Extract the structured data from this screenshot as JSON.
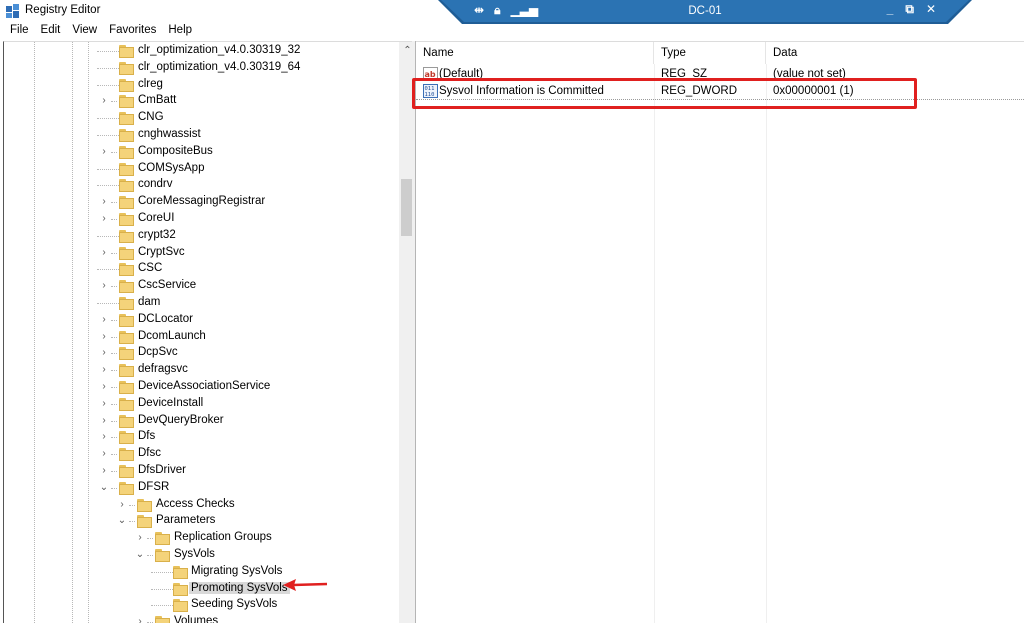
{
  "window": {
    "title": "Registry Editor"
  },
  "remote_bar": {
    "title": "DC-01",
    "left_icons": [
      "pin-icon",
      "lock-icon",
      "signal-icon"
    ],
    "right_icons": [
      "minimize-icon",
      "restore-icon",
      "close-icon"
    ]
  },
  "menu": [
    "File",
    "Edit",
    "View",
    "Favorites",
    "Help"
  ],
  "tree": {
    "items": [
      {
        "label": "clr_optimization_v4.0.30319_32",
        "level": 0,
        "expander": "none"
      },
      {
        "label": "clr_optimization_v4.0.30319_64",
        "level": 0,
        "expander": "none"
      },
      {
        "label": "clreg",
        "level": 0,
        "expander": "none"
      },
      {
        "label": "CmBatt",
        "level": 0,
        "expander": "collapsed"
      },
      {
        "label": "CNG",
        "level": 0,
        "expander": "none"
      },
      {
        "label": "cnghwassist",
        "level": 0,
        "expander": "none"
      },
      {
        "label": "CompositeBus",
        "level": 0,
        "expander": "collapsed"
      },
      {
        "label": "COMSysApp",
        "level": 0,
        "expander": "none"
      },
      {
        "label": "condrv",
        "level": 0,
        "expander": "none"
      },
      {
        "label": "CoreMessagingRegistrar",
        "level": 0,
        "expander": "collapsed"
      },
      {
        "label": "CoreUI",
        "level": 0,
        "expander": "collapsed"
      },
      {
        "label": "crypt32",
        "level": 0,
        "expander": "none"
      },
      {
        "label": "CryptSvc",
        "level": 0,
        "expander": "collapsed"
      },
      {
        "label": "CSC",
        "level": 0,
        "expander": "none"
      },
      {
        "label": "CscService",
        "level": 0,
        "expander": "collapsed"
      },
      {
        "label": "dam",
        "level": 0,
        "expander": "none"
      },
      {
        "label": "DCLocator",
        "level": 0,
        "expander": "collapsed"
      },
      {
        "label": "DcomLaunch",
        "level": 0,
        "expander": "collapsed"
      },
      {
        "label": "DcpSvc",
        "level": 0,
        "expander": "collapsed"
      },
      {
        "label": "defragsvc",
        "level": 0,
        "expander": "collapsed"
      },
      {
        "label": "DeviceAssociationService",
        "level": 0,
        "expander": "collapsed"
      },
      {
        "label": "DeviceInstall",
        "level": 0,
        "expander": "collapsed"
      },
      {
        "label": "DevQueryBroker",
        "level": 0,
        "expander": "collapsed"
      },
      {
        "label": "Dfs",
        "level": 0,
        "expander": "collapsed"
      },
      {
        "label": "Dfsc",
        "level": 0,
        "expander": "collapsed"
      },
      {
        "label": "DfsDriver",
        "level": 0,
        "expander": "collapsed"
      },
      {
        "label": "DFSR",
        "level": 0,
        "expander": "expanded"
      },
      {
        "label": "Access Checks",
        "level": 1,
        "expander": "collapsed"
      },
      {
        "label": "Parameters",
        "level": 1,
        "expander": "expanded"
      },
      {
        "label": "Replication Groups",
        "level": 2,
        "expander": "collapsed"
      },
      {
        "label": "SysVols",
        "level": 2,
        "expander": "expanded"
      },
      {
        "label": "Migrating SysVols",
        "level": 3,
        "expander": "none"
      },
      {
        "label": "Promoting SysVols",
        "level": 3,
        "expander": "none",
        "selected": true
      },
      {
        "label": "Seeding SysVols",
        "level": 3,
        "expander": "none"
      },
      {
        "label": "Volumes",
        "level": 2,
        "expander": "collapsed"
      }
    ]
  },
  "list": {
    "columns": [
      "Name",
      "Type",
      "Data"
    ],
    "rows": [
      {
        "icon": "string-value-icon",
        "name": "(Default)",
        "type": "REG_SZ",
        "data": "(value not set)"
      },
      {
        "icon": "dword-value-icon",
        "name": "Sysvol Information is Committed",
        "type": "REG_DWORD",
        "data": "0x00000001 (1)"
      }
    ]
  },
  "annotation": {
    "highlight_color": "#e0201f"
  }
}
